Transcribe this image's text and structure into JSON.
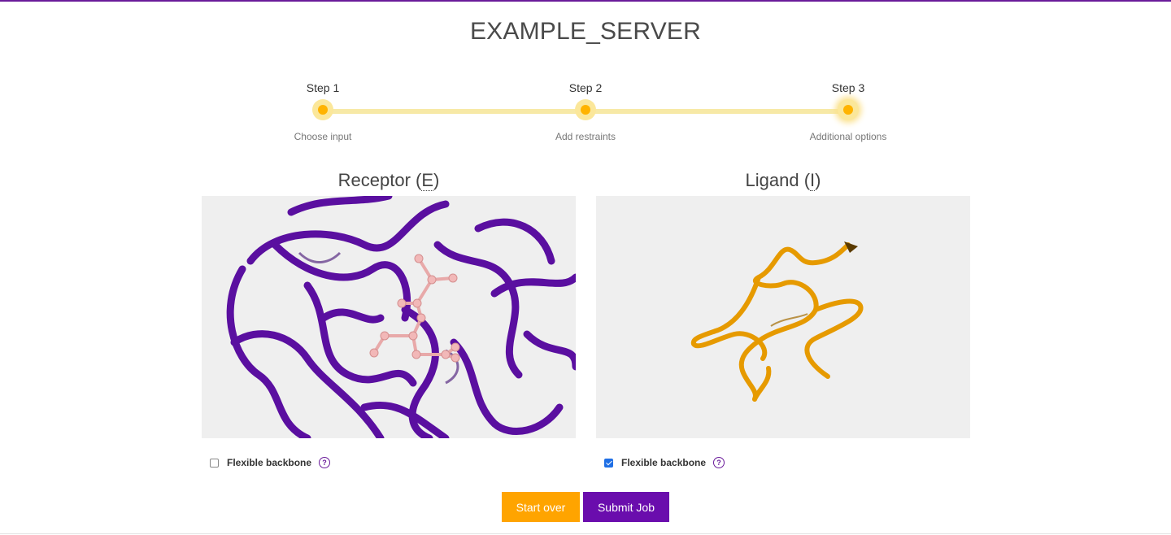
{
  "app": {
    "title": "EXAMPLE_SERVER"
  },
  "colors": {
    "accent": "#6a1b9a",
    "step": "#ffb300",
    "start_button": "#ffa400",
    "submit_button": "#6a0dad",
    "receptor": "#5a0fa0",
    "ligand": "#e69a00"
  },
  "steps": [
    {
      "label": "Step 1",
      "description": "Choose input",
      "active": false
    },
    {
      "label": "Step 2",
      "description": "Add restraints",
      "active": false
    },
    {
      "label": "Step 3",
      "description": "Additional options",
      "active": true
    }
  ],
  "receptor": {
    "title_prefix": "Receptor (",
    "title_abbr": "E",
    "title_suffix": ")",
    "option_label": "Flexible backbone",
    "flexible_backbone": false,
    "help_icon": "question-circle-icon"
  },
  "ligand": {
    "title_prefix": "Ligand (",
    "title_abbr": "I",
    "title_suffix": ")",
    "option_label": "Flexible backbone",
    "flexible_backbone": true,
    "help_icon": "question-circle-icon"
  },
  "actions": {
    "start_over": "Start over",
    "submit_job": "Submit Job"
  },
  "help_glyph": "?"
}
